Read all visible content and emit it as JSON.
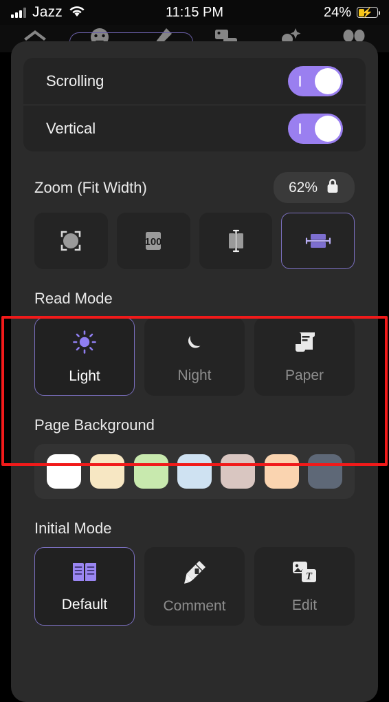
{
  "status_bar": {
    "carrier": "Jazz",
    "time": "11:15 PM",
    "battery_percent": "24%",
    "signal_icon": "cellular-signal-icon",
    "wifi_icon": "wifi-icon",
    "battery_icon": "battery-charging-icon"
  },
  "top_nav": {
    "items": [
      {
        "icon": "home-icon"
      },
      {
        "icon": "face-icon"
      },
      {
        "icon": "marker-pen-icon"
      },
      {
        "icon": "image-icon"
      },
      {
        "icon": "ai-sparkle-icon"
      },
      {
        "icon": "quote-icon"
      }
    ]
  },
  "toggles": [
    {
      "label": "Scrolling",
      "on": true
    },
    {
      "label": "Vertical",
      "on": true
    }
  ],
  "zoom": {
    "title": "Zoom (Fit Width)",
    "value": "62%",
    "lock_icon": "lock-icon",
    "modes": [
      {
        "name": "fit-page",
        "icon": "fit-page-icon",
        "selected": false
      },
      {
        "name": "actual-size",
        "icon": "one-hundred-percent-icon",
        "label": "100",
        "selected": false
      },
      {
        "name": "fit-height",
        "icon": "fit-height-icon",
        "selected": false
      },
      {
        "name": "fit-width",
        "icon": "fit-width-icon",
        "selected": true
      }
    ]
  },
  "read_mode": {
    "title": "Read Mode",
    "options": [
      {
        "label": "Light",
        "icon": "sun-icon",
        "selected": true
      },
      {
        "label": "Night",
        "icon": "moon-icon",
        "selected": false
      },
      {
        "label": "Paper",
        "icon": "scroll-icon",
        "selected": false
      }
    ]
  },
  "page_background": {
    "title": "Page Background",
    "swatches": [
      {
        "name": "white",
        "color": "#ffffff"
      },
      {
        "name": "cream",
        "color": "#f7e7c3"
      },
      {
        "name": "green",
        "color": "#c8e9ae"
      },
      {
        "name": "blue",
        "color": "#cfe2f2"
      },
      {
        "name": "rose",
        "color": "#d9c6c1"
      },
      {
        "name": "peach",
        "color": "#fad4b0"
      },
      {
        "name": "slate",
        "color": "#5e6877"
      }
    ]
  },
  "initial_mode": {
    "title": "Initial Mode",
    "options": [
      {
        "label": "Default",
        "icon": "open-book-icon",
        "selected": true
      },
      {
        "label": "Comment",
        "icon": "highlighter-icon",
        "selected": false
      },
      {
        "label": "Edit",
        "icon": "image-text-icon",
        "selected": false
      }
    ]
  },
  "annotation": {
    "color": "#f11a1a",
    "target": "read-mode-section"
  }
}
